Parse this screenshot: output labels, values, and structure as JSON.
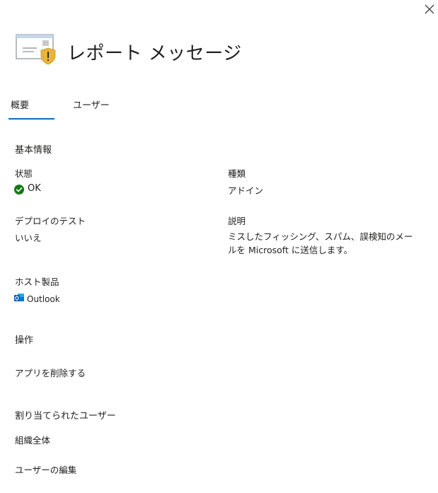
{
  "header": {
    "title": "レポート メッセージ",
    "app_icon": "report-message-envelope-shield-icon",
    "close_icon": "close-icon"
  },
  "tabs": [
    {
      "label": "概要",
      "active": true
    },
    {
      "label": "ユーザー",
      "active": false
    }
  ],
  "basic_info": {
    "heading": "基本情報",
    "status_label": "状態",
    "status_value": "OK",
    "type_label": "種類",
    "type_value": "アドイン",
    "deploy_test_label": "デプロイのテスト",
    "deploy_test_value": "いいえ",
    "description_label": "説明",
    "description_value": "ミスしたフィッシング、スパム、誤検知のメールを Microsoft に送信します。",
    "host_label": "ホスト製品",
    "host_value": "Outlook"
  },
  "actions": {
    "heading": "操作",
    "remove_app": "アプリを削除する"
  },
  "assigned_users": {
    "heading": "割り当てられたユーザー",
    "value": "組織全体",
    "edit_users": "ユーザーの編集"
  },
  "colors": {
    "accent": "#0f6cbd",
    "ok_green": "#107c10",
    "shield_yellow": "#e8b53c",
    "outlook_blue": "#0078d4"
  }
}
